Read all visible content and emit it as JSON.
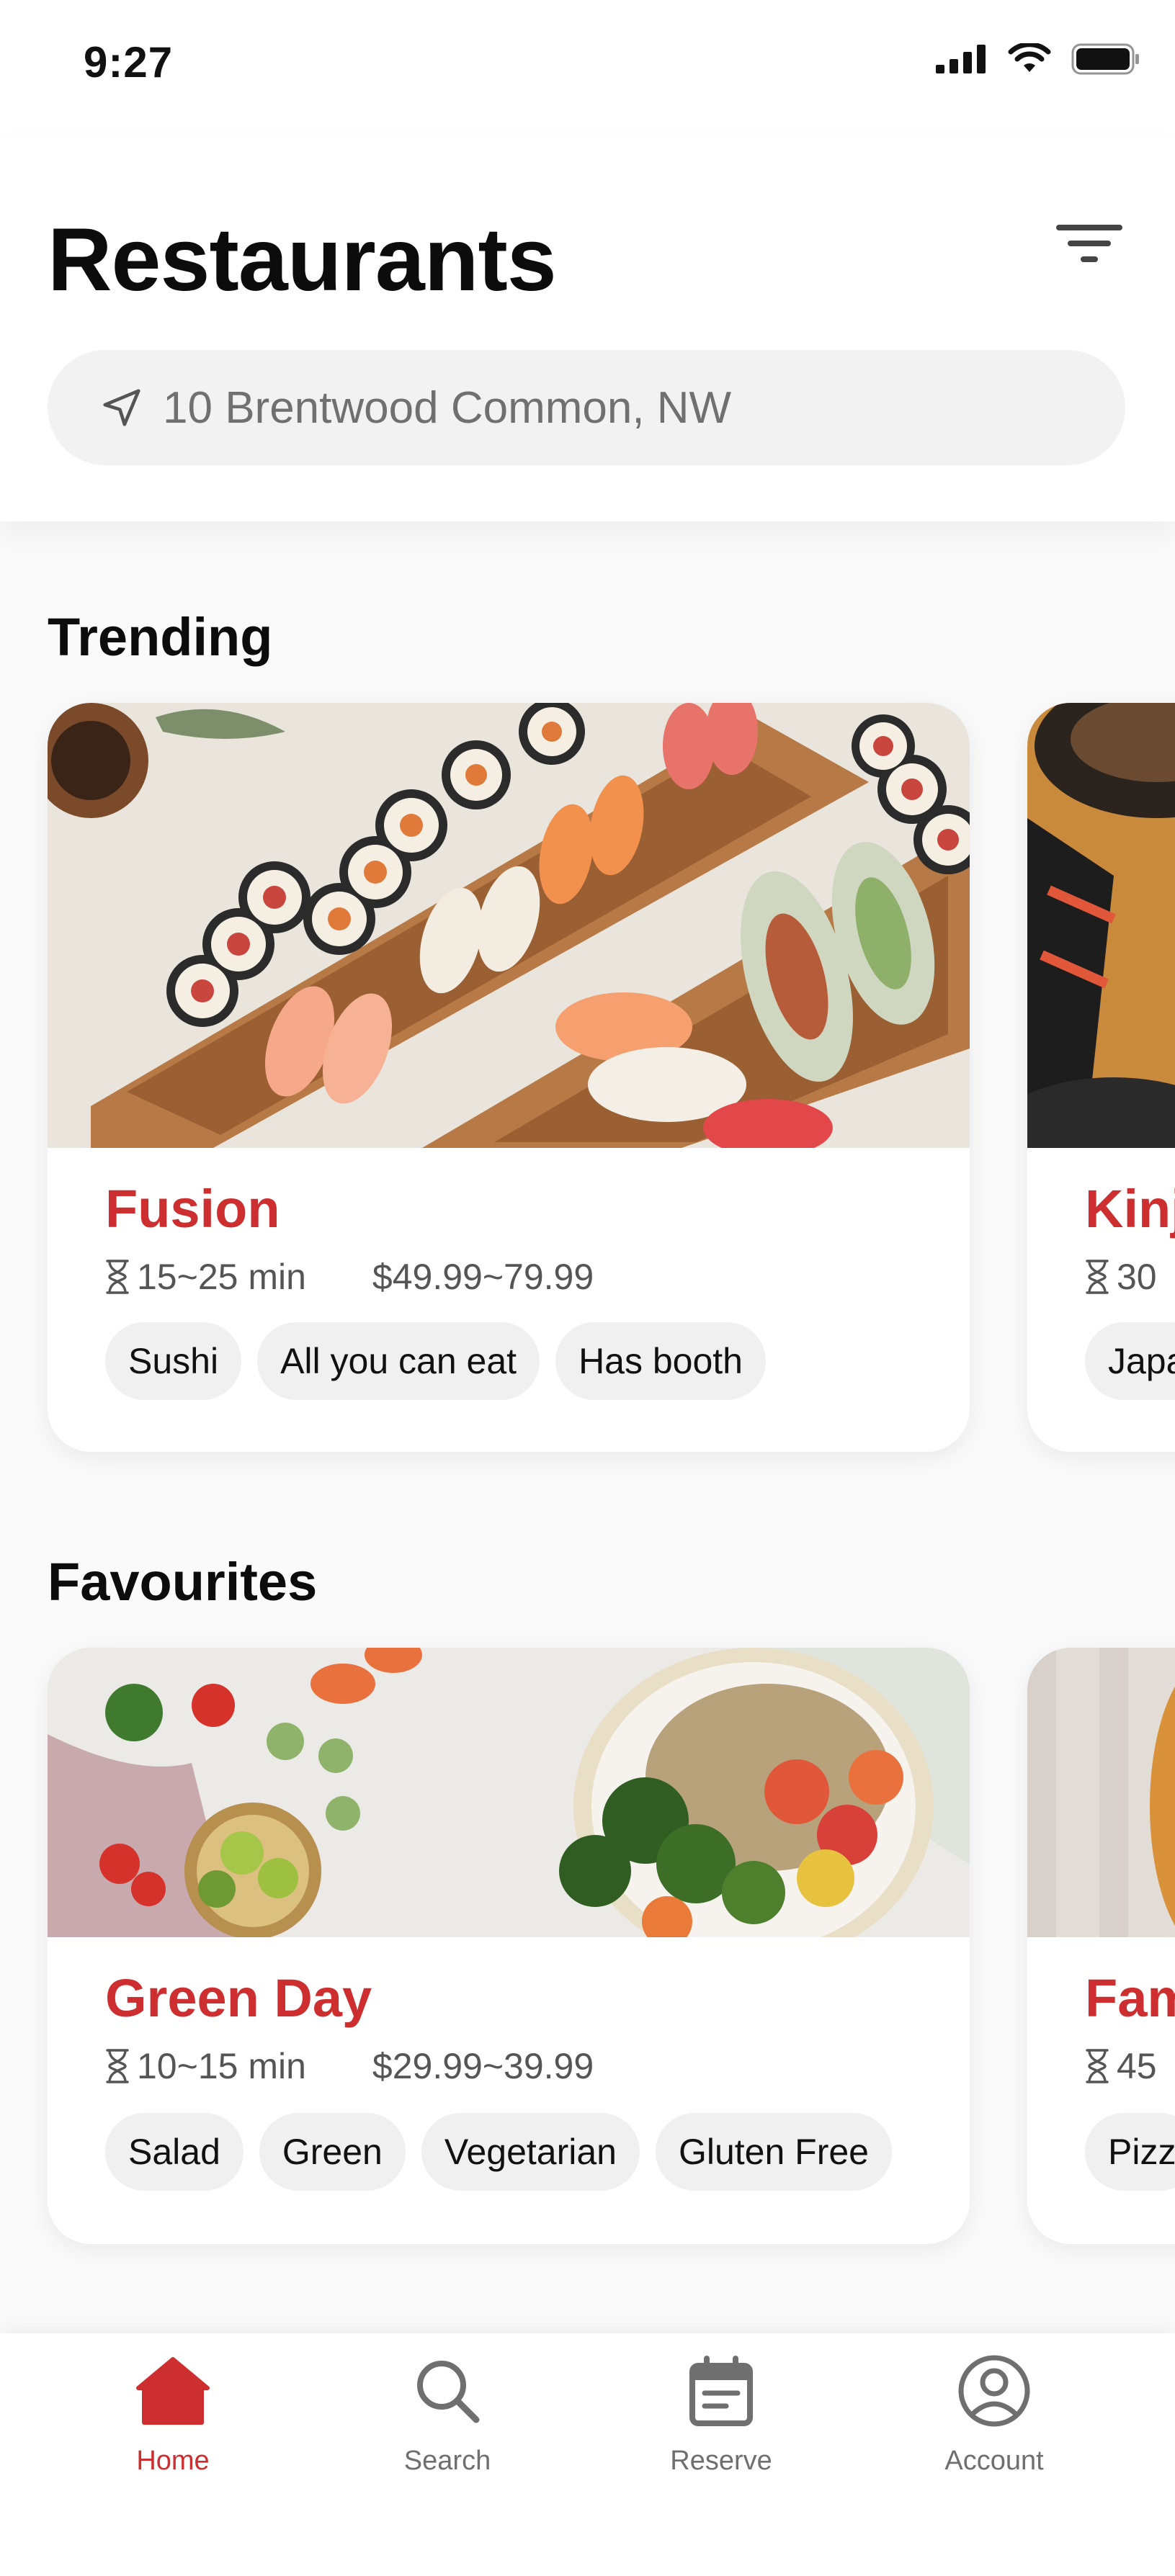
{
  "status_bar": {
    "time": "9:27"
  },
  "header": {
    "title": "Restaurants",
    "filter_icon": "filter-icon",
    "location_icon": "navigation-arrow-icon",
    "location_placeholder": "10 Brentwood Common, NW"
  },
  "sections": {
    "trending": {
      "title": "Trending",
      "cards": [
        {
          "name": "Fusion",
          "time": "15~25 min",
          "price": "$49.99~79.99",
          "tags": [
            "Sushi",
            "All you can eat",
            "Has booth"
          ]
        },
        {
          "name": "Kinj",
          "time": "30",
          "tags": [
            "Japa"
          ]
        }
      ]
    },
    "favourites": {
      "title": "Favourites",
      "cards": [
        {
          "name": "Green Day",
          "time": "10~15 min",
          "price": "$29.99~39.99",
          "tags": [
            "Salad",
            "Green",
            "Vegetarian",
            "Gluten Free"
          ]
        },
        {
          "name": "Fam",
          "time": "45",
          "tags": [
            "Pizz"
          ]
        }
      ]
    }
  },
  "tab_bar": {
    "tabs": [
      {
        "label": "Home",
        "icon": "home-icon",
        "active": true
      },
      {
        "label": "Search",
        "icon": "search-icon",
        "active": false
      },
      {
        "label": "Reserve",
        "icon": "calendar-icon",
        "active": false
      },
      {
        "label": "Account",
        "icon": "user-circle-icon",
        "active": false
      }
    ]
  },
  "colors": {
    "accent": "#cd2e2f",
    "text": "#0c0c0c",
    "muted": "#6f6f6f",
    "chip": "#f0f0f0"
  }
}
